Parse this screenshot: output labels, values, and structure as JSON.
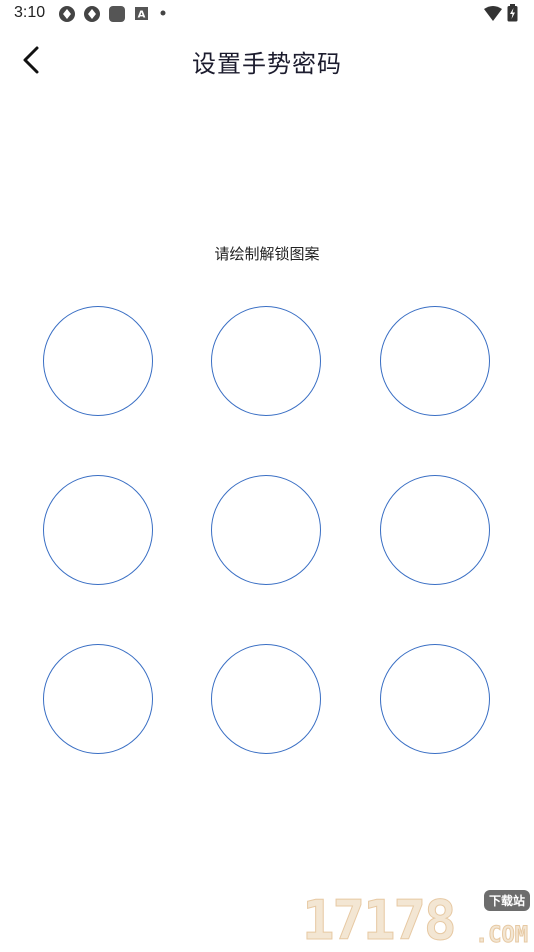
{
  "status_bar": {
    "time": "3:10",
    "icons": [
      "app-icon",
      "app-icon",
      "square-app-icon",
      "a-badge-icon",
      "dot-icon"
    ],
    "right_icons": [
      "wifi-icon",
      "battery-icon"
    ]
  },
  "header": {
    "back_icon": "chevron-left-icon",
    "title": "设置手势密码"
  },
  "main": {
    "hint": "请绘制解锁图案",
    "pattern": {
      "dots": 9,
      "rows": 3,
      "cols": 3,
      "ring_color": "#3a6fc4"
    }
  },
  "watermark": {
    "digits": "17178",
    "badge": "下载站",
    "domain": ".COM"
  }
}
